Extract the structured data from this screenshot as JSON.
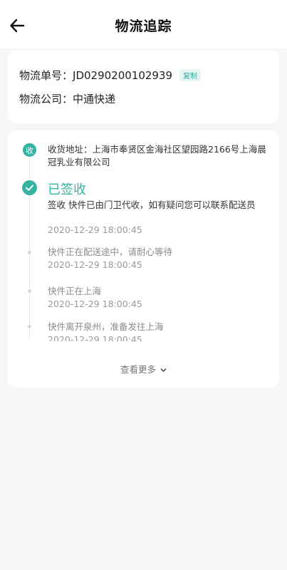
{
  "header": {
    "title": "物流追踪",
    "back_icon": "arrow-left-icon"
  },
  "info": {
    "tracking_label": "物流单号：",
    "tracking_number": "JD0290200102939",
    "copy_label": "复制",
    "company_label": "物流公司：",
    "company_name": "中通快递"
  },
  "tracking": {
    "receive_badge": "收",
    "address": "收货地址：上海市奉贤区金海社区望园路2166号上海晨冠乳业有限公司",
    "signed_title": "已签收",
    "events": [
      {
        "text": "签收 快件已由门卫代收，如有疑问您可以联系配送员",
        "time": "2020-12-29 18:00:45"
      },
      {
        "text": "快件正在配送途中，请耐心等待",
        "time": "2020-12-29 18:00:45"
      },
      {
        "text": "快件正在上海",
        "time": "2020-12-29 18:00:45"
      },
      {
        "text": "快件离开泉州，准备发往上海",
        "time": "2020-12-29 18:00:45"
      }
    ],
    "more_label": "查看更多"
  },
  "colors": {
    "accent": "#35b3a2",
    "background": "#f6f6f6"
  }
}
